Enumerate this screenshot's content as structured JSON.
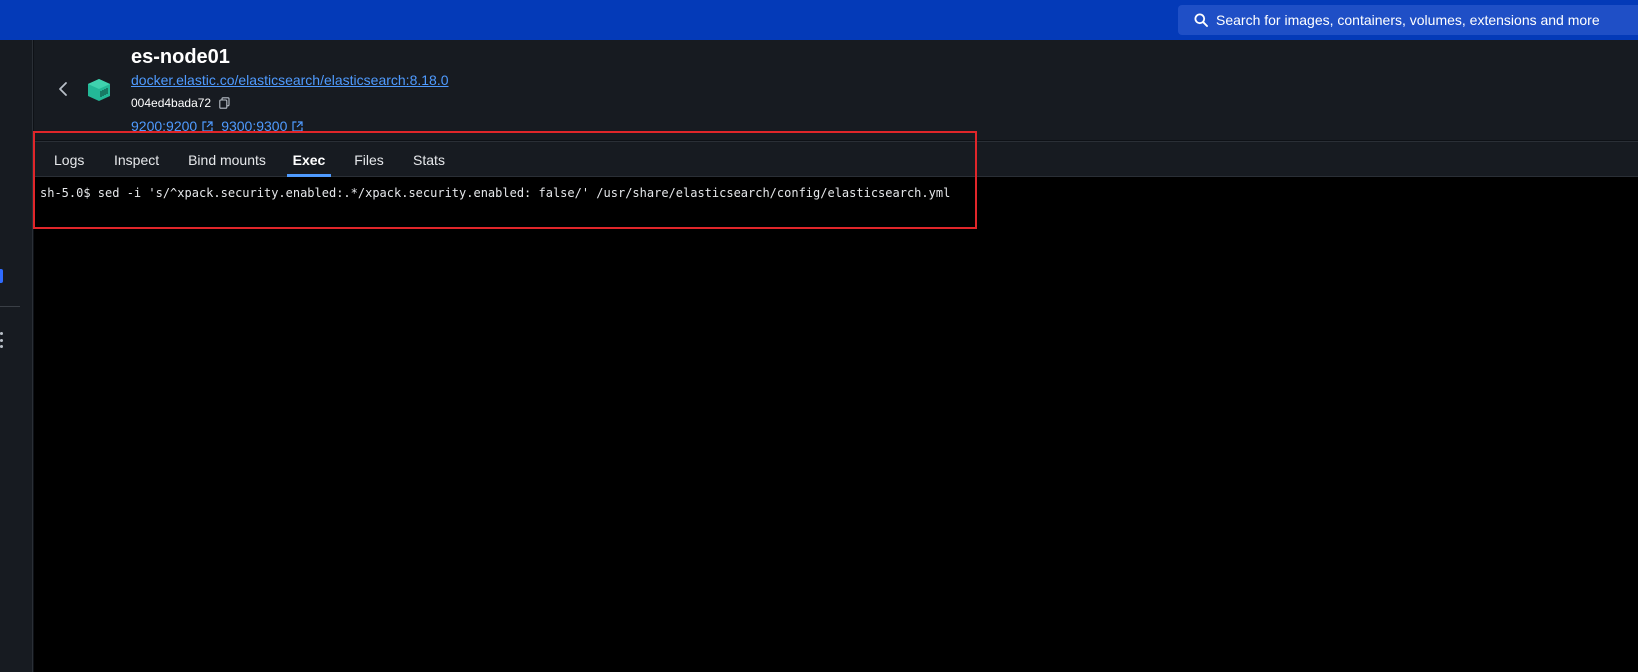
{
  "topbar": {
    "search_placeholder": "Search for images, containers, volumes, extensions and more",
    "search_icon": "search-icon"
  },
  "container": {
    "name": "es-node01",
    "image": "docker.elastic.co/elasticsearch/elasticsearch:8.18.0",
    "id": "004ed4bada72",
    "icon": "container-cube-icon",
    "ports": [
      {
        "label": "9200:9200",
        "icon": "external-link-icon"
      },
      {
        "label": "9300:9300",
        "icon": "external-link-icon"
      }
    ]
  },
  "tabs": [
    {
      "label": "Logs",
      "active": false
    },
    {
      "label": "Inspect",
      "active": false
    },
    {
      "label": "Bind mounts",
      "active": false
    },
    {
      "label": "Exec",
      "active": true
    },
    {
      "label": "Files",
      "active": false
    },
    {
      "label": "Stats",
      "active": false
    }
  ],
  "terminal": {
    "line": "sh-5.0$ sed -i 's/^xpack.security.enabled:.*/xpack.security.enabled: false/' /usr/share/elasticsearch/config/elasticsearch.yml"
  },
  "colors": {
    "topbar": "#043ab8",
    "accent": "#4f9bff",
    "highlight": "#e0262a",
    "container_icon": "#23b897"
  }
}
